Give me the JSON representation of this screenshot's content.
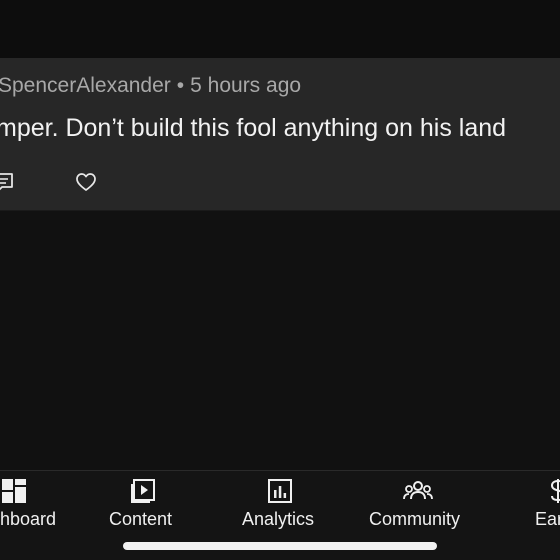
{
  "comment": {
    "author": "SpencerAlexander",
    "separator": "•",
    "time": "5 hours ago",
    "text": "mper. Don’t build this fool anything on his land"
  },
  "icons": {
    "reply": "reply-comment-icon",
    "like": "heart-icon"
  },
  "nav": {
    "items": [
      {
        "label": "hboard",
        "icon": "dashboard-icon"
      },
      {
        "label": "Content",
        "icon": "content-icon"
      },
      {
        "label": "Analytics",
        "icon": "analytics-icon"
      },
      {
        "label": "Community",
        "icon": "community-icon"
      },
      {
        "label": "Ear",
        "icon": "earn-icon"
      }
    ]
  },
  "colors": {
    "background": "#111111",
    "card": "#272727",
    "text": "#f2f2f2",
    "muted": "#a8a8a8"
  }
}
